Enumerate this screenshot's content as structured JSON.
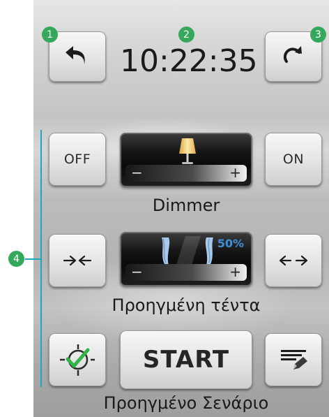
{
  "header": {
    "back_icon": "back-arrow-icon",
    "clock": "10:22:35",
    "refresh_icon": "refresh-arrow-icon"
  },
  "callouts": [
    "1",
    "2",
    "3",
    "4"
  ],
  "dimmer": {
    "off_label": "OFF",
    "on_label": "ON",
    "minus": "−",
    "plus": "+",
    "icon": "lamp-icon",
    "label": "Dimmer"
  },
  "awning": {
    "close_icon": "arrows-inward-icon",
    "open_icon": "arrows-outward-icon",
    "icon": "curtain-icon",
    "percent": "50%",
    "minus": "−",
    "plus": "+",
    "label": "Προηγμένη τέντα"
  },
  "scenario": {
    "enable_icon": "scenario-enable-icon",
    "start_label": "START",
    "edit_icon": "edit-icon",
    "label": "Προηγμένο Σενάριο"
  },
  "colors": {
    "accent": "#1aa8bf",
    "badge": "#36a85c",
    "percent": "#3f8fd8",
    "check": "#2fb34a"
  }
}
